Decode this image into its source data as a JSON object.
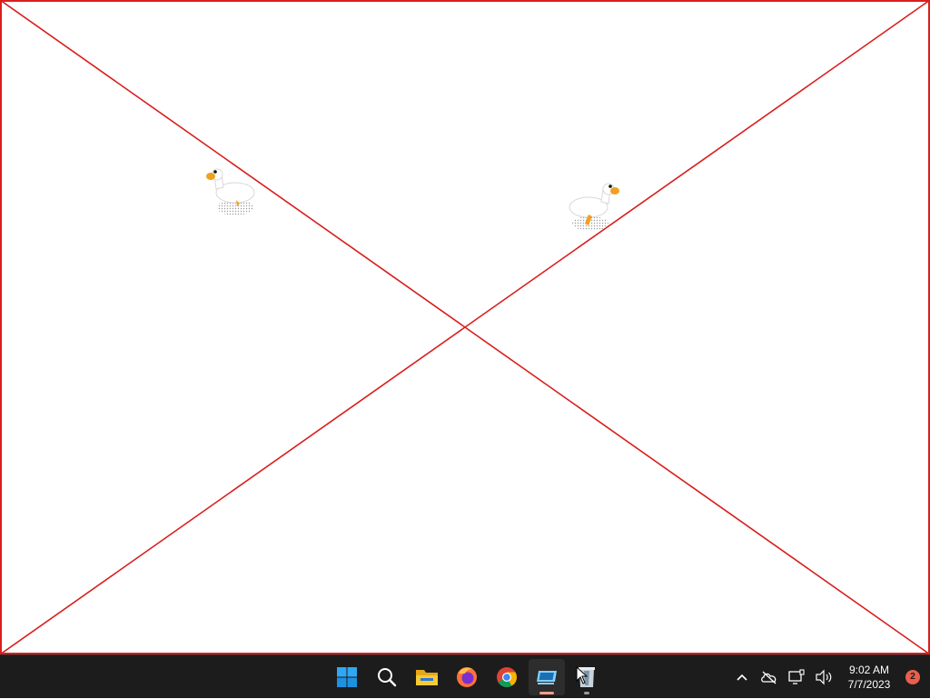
{
  "desktop": {
    "placeholder_line_color": "#d91e1e",
    "geese": [
      {
        "name": "goose-left",
        "facing": "left"
      },
      {
        "name": "goose-right",
        "facing": "right"
      }
    ]
  },
  "taskbar": {
    "apps": [
      {
        "name": "start-button",
        "icon": "windows-logo-icon"
      },
      {
        "name": "search-button",
        "icon": "search-icon"
      },
      {
        "name": "file-explorer-button",
        "icon": "folder-icon"
      },
      {
        "name": "firefox-button",
        "icon": "firefox-icon"
      },
      {
        "name": "chrome-button",
        "icon": "chrome-icon"
      },
      {
        "name": "remote-desktop-button",
        "icon": "monitor-app-icon",
        "state": "active"
      },
      {
        "name": "recycle-app-button",
        "icon": "bin-app-icon",
        "state": "open"
      }
    ],
    "tray": {
      "icons": [
        "chevron-up-icon",
        "cloud-offline-icon",
        "network-icon",
        "volume-icon"
      ],
      "time": "9:02 AM",
      "date": "7/7/2023",
      "notification_count": "2"
    }
  }
}
